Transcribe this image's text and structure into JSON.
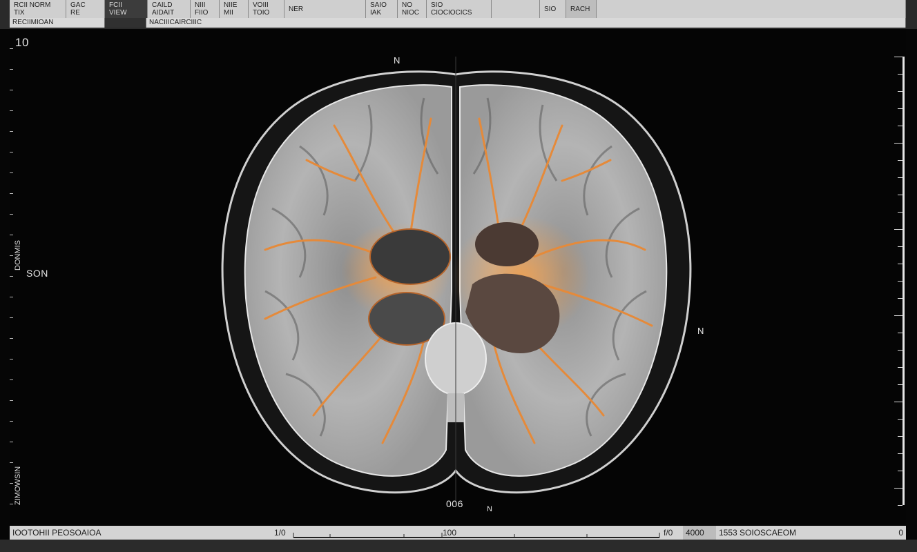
{
  "header": {
    "cells": [
      {
        "line1": "RCII NORM",
        "line2": "TIX",
        "width": 82
      },
      {
        "line1": "GAC",
        "line2": "RE",
        "width": 56
      },
      {
        "line1": "FCII",
        "line2": "VIEW",
        "width": 62,
        "dark": true
      },
      {
        "line1": "CAILD",
        "line2": "AIDAIT",
        "width": 62
      },
      {
        "line1": "NIII",
        "line2": "FIIO",
        "width": 42
      },
      {
        "line1": "NIIE",
        "line2": "MII",
        "width": 42
      },
      {
        "line1": "VOIII",
        "line2": "TOIO",
        "width": 52
      },
      {
        "line1": "NER",
        "line2": "",
        "width": 118
      },
      {
        "line1": "SAIO",
        "line2": "IAK",
        "width": 46
      },
      {
        "line1": "NO",
        "line2": "NIOC",
        "width": 42
      },
      {
        "line1": "SIO",
        "line2": "CIOCIOCICS",
        "width": 94
      },
      {
        "line1": "",
        "line2": "",
        "width": 70
      },
      {
        "line1": "SIO",
        "line2": "",
        "width": 38
      },
      {
        "line1": "RACH",
        "line2": "",
        "width": 44,
        "button": true
      },
      {
        "line1": "",
        "line2": "",
        "width": 448
      }
    ],
    "sub_left": "RECIIMIOAN",
    "sub_mid": "",
    "sub_right": "NACIIICAIRCIIIC"
  },
  "overlay": {
    "top_left_number": "10",
    "orientation_top": "N",
    "orientation_right": "N",
    "left_label": "SON",
    "left_vertical_top": "DONMIS",
    "left_vertical_bottom": "ZIMOWSIN",
    "bottom_center": "006",
    "bottom_marker": "N"
  },
  "status": {
    "left": "IOOTOHII PEOSOAIOA",
    "scale_left": "1/0",
    "scale_mid": "100",
    "scale_right": "f/0",
    "info_a": "4000",
    "info_b": "1553 SOIOSCAEOM",
    "right_value": "0"
  },
  "colors": {
    "background": "#050505",
    "header_light": "#cfcfcf",
    "overlay_text": "#e6e6e6",
    "highlight": "#f0963a"
  }
}
